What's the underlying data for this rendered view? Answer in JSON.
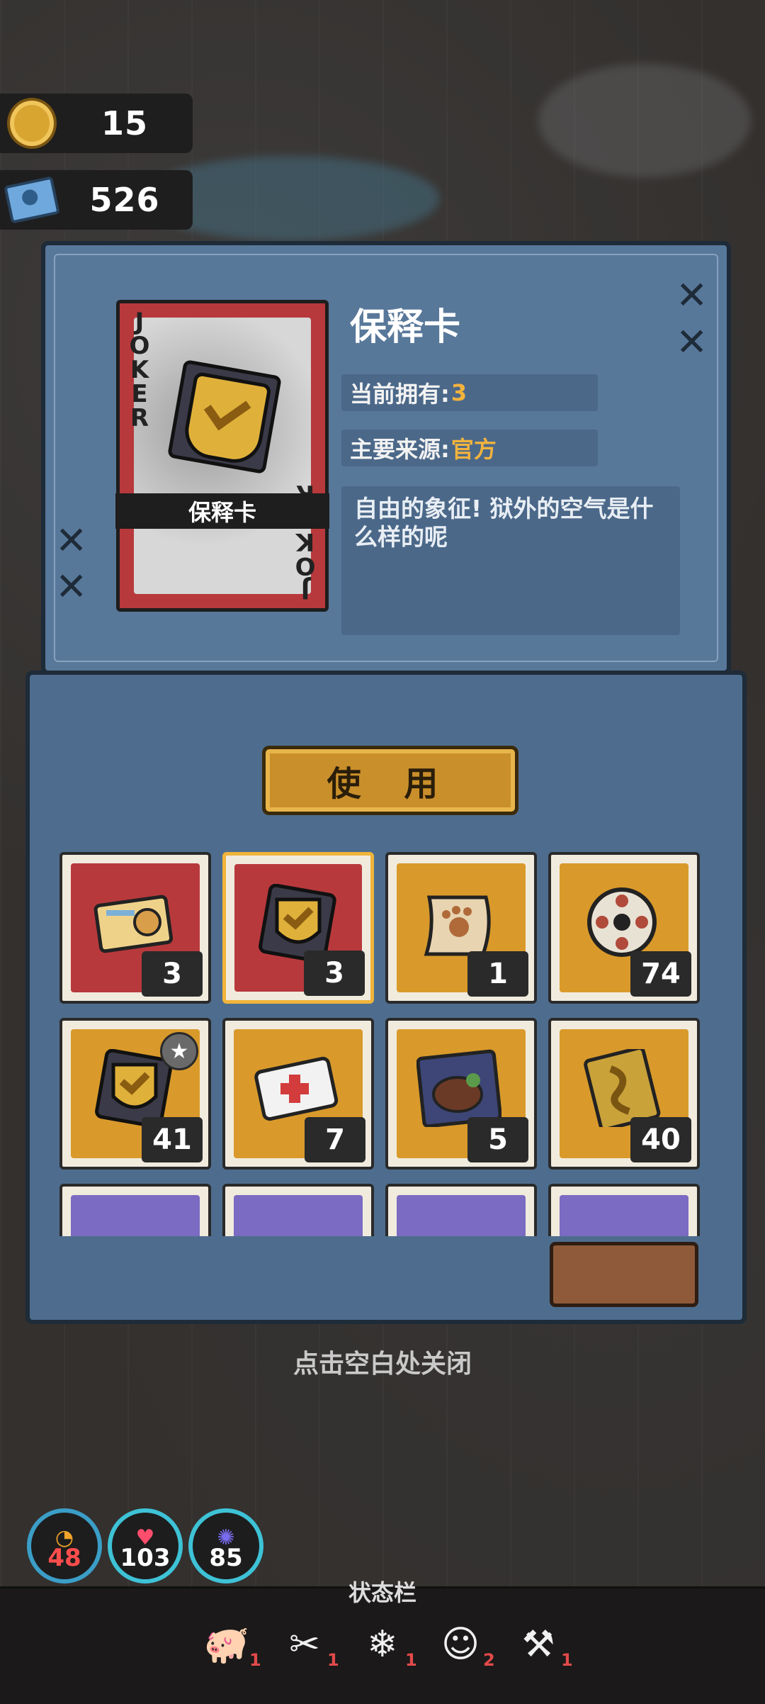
{
  "currency": {
    "coins": "15",
    "tickets": "526"
  },
  "item": {
    "card_name": "保释卡",
    "card_joker_text": "JOKER",
    "title": "保释卡",
    "owned_label": "当前拥有:",
    "owned_value": "3",
    "source_label": "主要来源:",
    "source_value": "官方",
    "description": "自由的象征! 狱外的空气是什么样的呢"
  },
  "use_button": "使 用",
  "inventory": [
    {
      "name": "id-card",
      "color": "#b8393c",
      "count": "3"
    },
    {
      "name": "bail-card",
      "color": "#b8393c",
      "count": "3",
      "selected": true
    },
    {
      "name": "paw-scroll",
      "color": "#d99a2b",
      "count": "1"
    },
    {
      "name": "film-reel",
      "color": "#d99a2b",
      "count": "74"
    },
    {
      "name": "bail-card-star",
      "color": "#d99a2b",
      "count": "41"
    },
    {
      "name": "medical-card",
      "color": "#d99a2b",
      "count": "7"
    },
    {
      "name": "steak-menu",
      "color": "#d99a2b",
      "count": "5"
    },
    {
      "name": "gold-ribbon-card",
      "color": "#d99a2b",
      "count": "40"
    },
    {
      "name": "blue-item-1",
      "color": "#7b6bc2",
      "count": ""
    },
    {
      "name": "blue-item-2",
      "color": "#7b6bc2",
      "count": ""
    },
    {
      "name": "blue-item-3",
      "color": "#7b6bc2",
      "count": ""
    },
    {
      "name": "blue-item-4",
      "color": "#7b6bc2",
      "count": ""
    }
  ],
  "close_hint": "点击空白处关闭",
  "stats": {
    "hunger": "48",
    "health": "103",
    "mind": "85"
  },
  "status_bar": {
    "title": "状态栏",
    "effects": [
      {
        "icon": "pig-down-icon",
        "count": "1"
      },
      {
        "icon": "tools-icon",
        "count": "1"
      },
      {
        "icon": "snowflake-icon",
        "count": "1"
      },
      {
        "icon": "masks-icon",
        "count": "2"
      },
      {
        "icon": "hammer-up-icon",
        "count": "1"
      }
    ]
  }
}
